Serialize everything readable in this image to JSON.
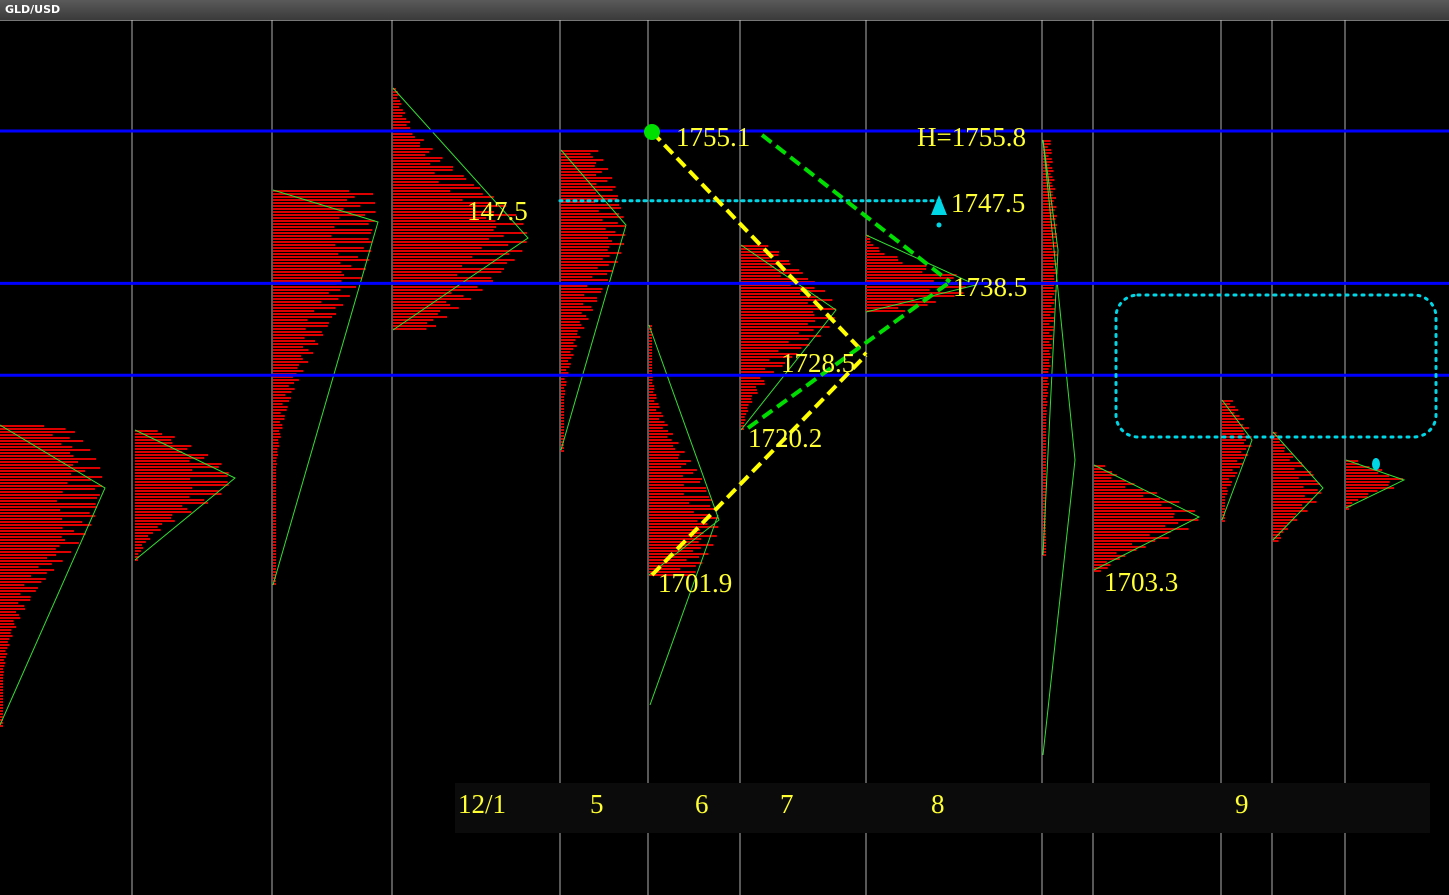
{
  "window": {
    "title": "GLD/USD"
  },
  "chart_data": {
    "type": "market-profile",
    "title": "",
    "xlabel": "",
    "ylabel": "",
    "ylim": [
      1690,
      1765
    ],
    "date_labels": [
      "12/1",
      "5",
      "6",
      "7",
      "8",
      "9"
    ],
    "horizontal_levels": [
      1755.1,
      1738.5,
      1728.5
    ],
    "price_annotations": [
      {
        "text": "1755.1",
        "price": 1755.1
      },
      {
        "text": "H=1755.8",
        "price": 1755.8
      },
      {
        "text": "147.5",
        "price": 1747.5
      },
      {
        "text": "1747.5",
        "price": 1747.5
      },
      {
        "text": "1738.5",
        "price": 1738.5
      },
      {
        "text": "1728.5",
        "price": 1728.5
      },
      {
        "text": "1720.2",
        "price": 1720.2
      },
      {
        "text": "1701.9",
        "price": 1701.9
      },
      {
        "text": "1703.3",
        "price": 1703.3
      }
    ],
    "colors": {
      "profile": "#dd0000",
      "level_line": "#0000ff",
      "annotation_text": "#ffff33",
      "yellow_trend": "#ffff00",
      "green_trend": "#00dd00",
      "cyan_marker": "#00d7e6",
      "session_separator": "#d0d0d0"
    }
  }
}
